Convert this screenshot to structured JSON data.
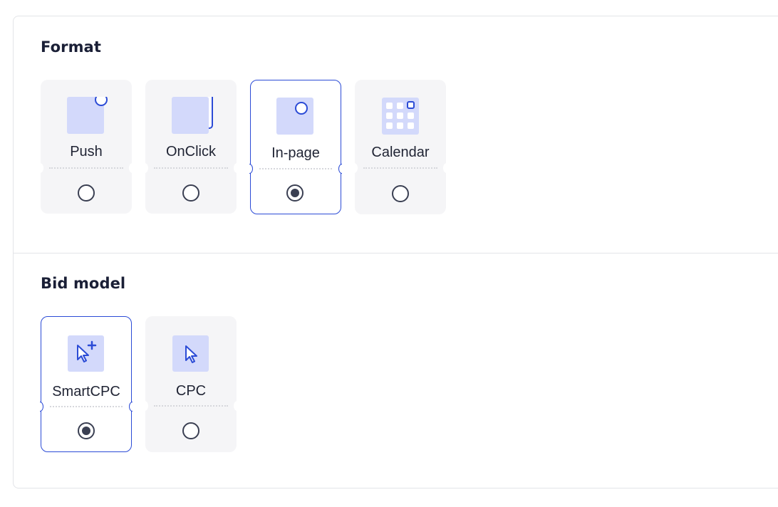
{
  "format": {
    "title": "Format",
    "options": [
      {
        "label": "Push",
        "icon": "push-icon",
        "selected": false
      },
      {
        "label": "OnClick",
        "icon": "onclick-icon",
        "selected": false
      },
      {
        "label": "In-page",
        "icon": "in-page-icon",
        "selected": true
      },
      {
        "label": "Calendar",
        "icon": "calendar-icon",
        "selected": false
      }
    ]
  },
  "bid_model": {
    "title": "Bid model",
    "options": [
      {
        "label": "SmartCPC",
        "icon": "smart-cursor-icon",
        "selected": true
      },
      {
        "label": "CPC",
        "icon": "cursor-icon",
        "selected": false
      }
    ]
  },
  "colors": {
    "accent": "#2b4bd6",
    "icon_fill": "#d3d9fb",
    "card_bg": "#f5f5f7",
    "radio": "#3a3f52"
  }
}
